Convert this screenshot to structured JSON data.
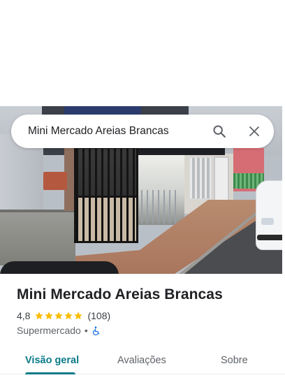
{
  "search": {
    "query": "Mini Mercado Areias Brancas"
  },
  "place": {
    "name": "Mini Mercado Areias Brancas",
    "rating": "4,8",
    "rating_numeric": 4.8,
    "review_count": "(108)",
    "category": "Supermercado",
    "separator": "•",
    "wheelchair_accessible": true
  },
  "tabs": [
    {
      "label": "Visão geral",
      "active": true
    },
    {
      "label": "Avaliações",
      "active": false
    },
    {
      "label": "Sobre",
      "active": false
    }
  ],
  "icons": {
    "search": "search-icon",
    "close": "close-icon",
    "star": "star-icon",
    "accessibility": "wheelchair-icon"
  },
  "colors": {
    "accent": "#0b7b88",
    "star": "#fbbc04",
    "accessibility_icon": "#1a73e8",
    "text_primary": "#202124",
    "text_secondary": "#5f6368"
  }
}
